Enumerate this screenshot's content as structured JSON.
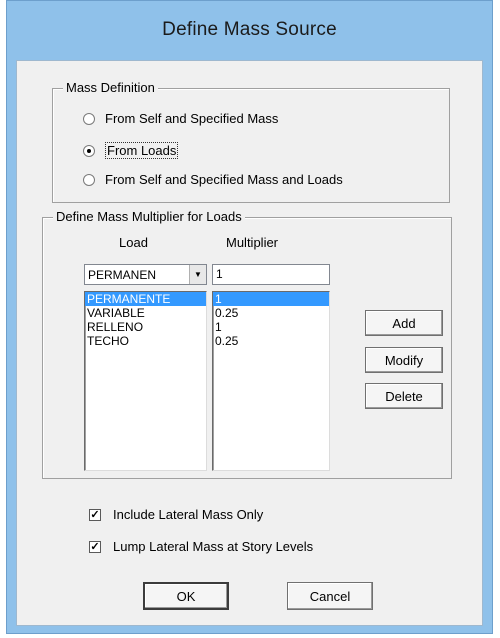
{
  "window": {
    "title": "Define Mass Source"
  },
  "mass_definition": {
    "legend": "Mass Definition",
    "options": [
      {
        "label": "From Self and Specified Mass",
        "checked": false
      },
      {
        "label": "From Loads",
        "checked": true
      },
      {
        "label": "From Self and Specified Mass and Loads",
        "checked": false
      }
    ]
  },
  "multiplier_group": {
    "legend": "Define Mass Multiplier for Loads",
    "load_header": "Load",
    "multiplier_header": "Multiplier",
    "load_combo_value": "PERMANEN",
    "multiplier_input_value": "1",
    "loads": [
      "PERMANENTE",
      "VARIABLE",
      "RELLENO",
      "TECHO"
    ],
    "multipliers": [
      "1",
      "0.25",
      "1",
      "0.25"
    ],
    "selected_index": 0
  },
  "buttons": {
    "add": "Add",
    "modify": "Modify",
    "delete": "Delete",
    "ok": "OK",
    "cancel": "Cancel"
  },
  "options": {
    "include_lateral_mass": {
      "label": "Include Lateral Mass Only",
      "checked": true
    },
    "lump_lateral_mass": {
      "label": "Lump Lateral Mass at Story Levels",
      "checked": true
    }
  },
  "colors": {
    "frame": "#8fc1ea",
    "selection": "#3399ff",
    "client": "#f0f0f0"
  }
}
